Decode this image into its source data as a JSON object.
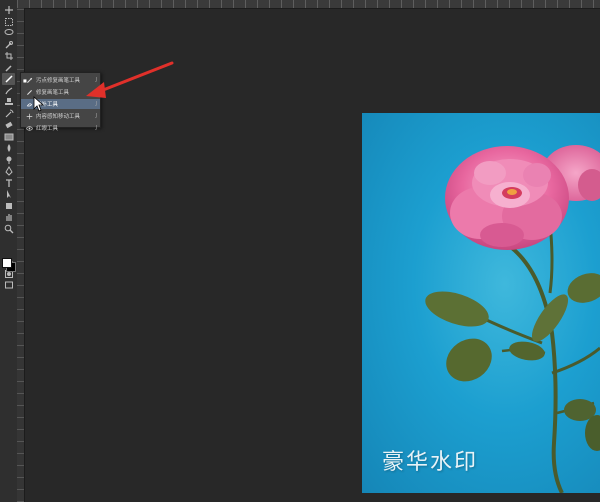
{
  "toolbar": {
    "tools": [
      "move-tool",
      "marquee-tool",
      "lasso-tool",
      "quick-select-tool",
      "crop-tool",
      "eyedropper-tool",
      "healing-brush-tool",
      "brush-tool",
      "clone-stamp-tool",
      "history-brush-tool",
      "eraser-tool",
      "gradient-tool",
      "blur-tool",
      "dodge-tool",
      "pen-tool",
      "type-tool",
      "path-select-tool",
      "shape-tool",
      "hand-tool",
      "zoom-tool",
      "edit-toolbar",
      "quick-mask",
      "screen-mode"
    ],
    "active_tool": "healing-brush-tool",
    "foreground_color": "#ffffff",
    "background_color": "#000000"
  },
  "flyout": {
    "items": [
      {
        "label": "污点修复画笔工具",
        "key": "J",
        "icon": "spot-healing-icon",
        "active": true
      },
      {
        "label": "修复画笔工具",
        "key": "J",
        "icon": "healing-brush-icon",
        "active": false
      },
      {
        "label": "修补工具",
        "key": "J",
        "icon": "patch-icon",
        "active": false,
        "highlighted": true
      },
      {
        "label": "内容感知移动工具",
        "key": "J",
        "icon": "content-aware-move-icon",
        "active": false
      },
      {
        "label": "红眼工具",
        "key": "J",
        "icon": "red-eye-icon",
        "active": false
      }
    ]
  },
  "annotation": {
    "color": "#e0302a"
  },
  "canvas": {
    "watermark_text": "豪华水印",
    "background_color": "#1c9fd0"
  }
}
